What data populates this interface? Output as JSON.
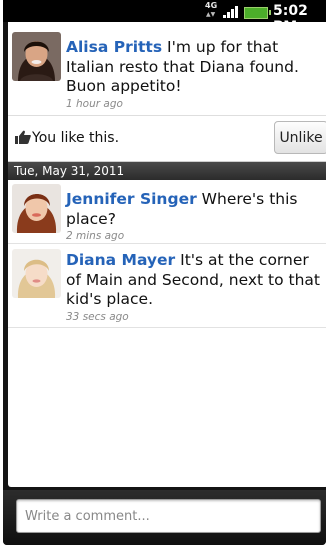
{
  "status_bar": {
    "network": "4G",
    "time": "5:02 PM",
    "colors": {
      "battery": "#4cae2a"
    }
  },
  "posts": [
    {
      "author": "Alisa Pritts",
      "text": "I'm up for that Italian resto that Diana found. Buon appetito!",
      "time": "1 hour ago",
      "avatar": "woman-dark-hair-avatar"
    },
    {
      "author": "Jennifer Singer",
      "text": "Where's this place?",
      "time": "2 mins ago",
      "avatar": "woman-red-hair-avatar"
    },
    {
      "author": "Diana Mayer",
      "text": "It's at the corner of Main and Second, next to that kid's place.",
      "time": "33 secs ago",
      "avatar": "woman-blonde-avatar"
    }
  ],
  "like_bar": {
    "text": "You like this.",
    "button": "Unlike",
    "icon": "thumbs-up-icon"
  },
  "date_header": "Tue, May 31, 2011",
  "comment": {
    "placeholder": "Write a comment...",
    "value": ""
  },
  "colors": {
    "author": "#2563b8",
    "time": "#8a8a8a",
    "date_bar": "#333333"
  }
}
